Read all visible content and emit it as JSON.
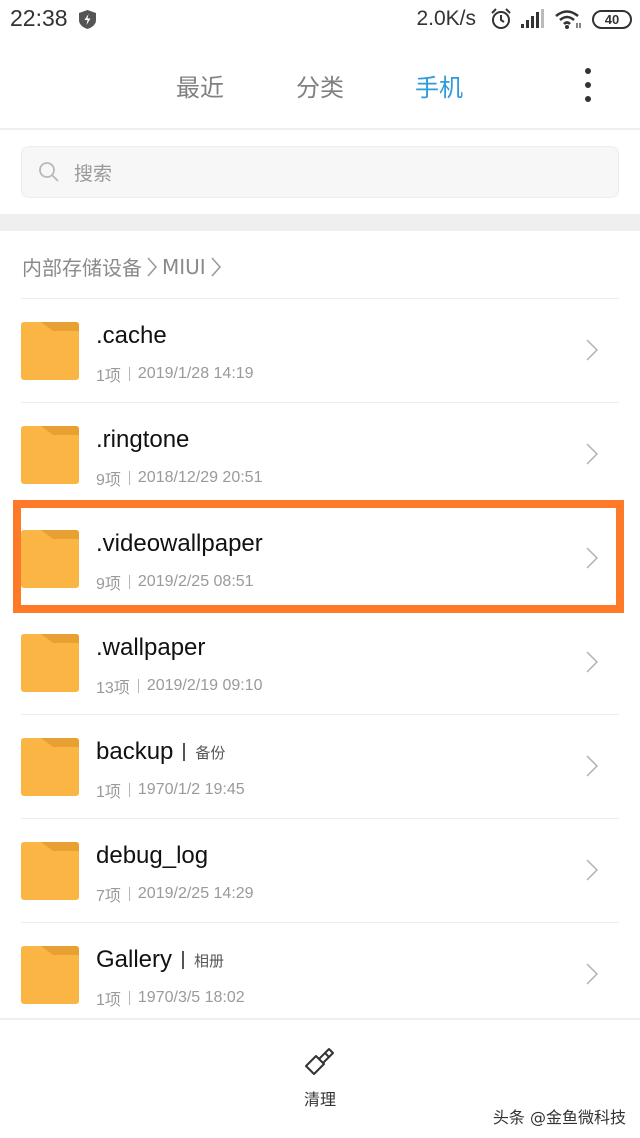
{
  "status_bar": {
    "time": "22:38",
    "net_speed": "2.0K/s",
    "battery": "40",
    "icons": [
      "shield-bolt-icon",
      "alarm-icon",
      "signal-icon",
      "wifi-icon",
      "battery-icon"
    ]
  },
  "tabs": [
    {
      "label": "最近",
      "active": false
    },
    {
      "label": "分类",
      "active": false
    },
    {
      "label": "手机",
      "active": true
    }
  ],
  "accent_color": "#2e9bdb",
  "highlight_color": "#ff7a28",
  "folder_color": "#fbb545",
  "search": {
    "placeholder": "搜索"
  },
  "breadcrumb": [
    "内部存储设备",
    "MIUI"
  ],
  "files": [
    {
      "name": ".cache",
      "tag": "",
      "count": "1项",
      "date": "2019/1/28 14:19"
    },
    {
      "name": ".ringtone",
      "tag": "",
      "count": "9项",
      "date": "2018/12/29 20:51"
    },
    {
      "name": ".videowallpaper",
      "tag": "",
      "count": "9项",
      "date": "2019/2/25 08:51",
      "highlighted": true
    },
    {
      "name": ".wallpaper",
      "tag": "",
      "count": "13项",
      "date": "2019/2/19 09:10"
    },
    {
      "name": "backup",
      "tag": "备份",
      "count": "1项",
      "date": "1970/1/2 19:45"
    },
    {
      "name": "debug_log",
      "tag": "",
      "count": "7项",
      "date": "2019/2/25 14:29"
    },
    {
      "name": "Gallery",
      "tag": "相册",
      "count": "1项",
      "date": "1970/3/5 18:02"
    }
  ],
  "bottom": {
    "clean_label": "清理"
  },
  "watermark": "头条 @金鱼微科技"
}
